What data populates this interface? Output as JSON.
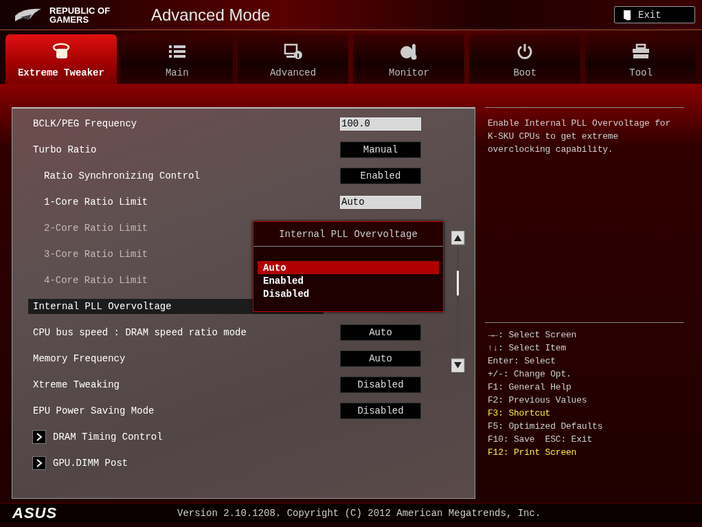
{
  "header": {
    "logo_text": "REPUBLIC OF GAMERS",
    "title": "Advanced Mode",
    "exit_button": "Exit"
  },
  "tabs": [
    {
      "label": "Extreme Tweaker",
      "kind": "tweaker",
      "selected": true
    },
    {
      "label": "Main",
      "kind": "list",
      "selected": false
    },
    {
      "label": "Advanced",
      "kind": "advanced",
      "selected": false
    },
    {
      "label": "Monitor",
      "kind": "monitor",
      "selected": false
    },
    {
      "label": "Boot",
      "kind": "power",
      "selected": false
    },
    {
      "label": "Tool",
      "kind": "tool",
      "selected": false
    }
  ],
  "settings": [
    {
      "label": "BCLK/PEG Frequency",
      "kind": "field",
      "value": "100.0",
      "disabled": false,
      "selected": false
    },
    {
      "label": "Turbo Ratio",
      "kind": "option",
      "value": "Manual",
      "disabled": false,
      "selected": false,
      "children": [
        {
          "label": "Ratio Synchronizing Control",
          "kind": "option",
          "value": "Enabled",
          "disabled": false,
          "selected": false
        },
        {
          "label": "1-Core Ratio Limit",
          "kind": "field",
          "value": "Auto",
          "disabled": false,
          "selected": false
        },
        {
          "label": "2-Core Ratio Limit",
          "kind": "none",
          "disabled": true,
          "selected": false
        },
        {
          "label": "3-Core Ratio Limit",
          "kind": "none",
          "disabled": true,
          "selected": false
        },
        {
          "label": "4-Core Ratio Limit",
          "kind": "none",
          "disabled": true,
          "selected": false
        }
      ]
    },
    {
      "label": "Internal PLL Overvoltage",
      "kind": "none",
      "disabled": false,
      "selected": true
    },
    {
      "label": "CPU bus speed : DRAM speed ratio mode",
      "kind": "option",
      "value": "Auto",
      "disabled": false,
      "selected": false
    },
    {
      "label": "Memory Frequency",
      "kind": "option",
      "value": "Auto",
      "disabled": false,
      "selected": false
    },
    {
      "label": "Xtreme Tweaking",
      "kind": "option",
      "value": "Disabled",
      "disabled": false,
      "selected": false
    },
    {
      "label": "EPU Power Saving Mode",
      "kind": "option",
      "value": "Disabled",
      "disabled": false,
      "selected": false
    },
    {
      "label": "DRAM Timing Control",
      "kind": "submenu",
      "disabled": false,
      "selected": false
    },
    {
      "label": "GPU.DIMM Post",
      "kind": "submenu",
      "disabled": false,
      "selected": false
    }
  ],
  "popup": {
    "title": "Internal PLL Overvoltage",
    "options": [
      {
        "label": "Auto",
        "selected": true
      },
      {
        "label": "Enabled",
        "selected": false
      },
      {
        "label": "Disabled",
        "selected": false
      }
    ]
  },
  "help_text": "Enable Internal PLL Overvoltage for K-SKU CPUs to get extreme overclocking capability.",
  "key_hints": [
    {
      "text": "→←: Select Screen",
      "highlight": false
    },
    {
      "text": "↑↓: Select Item",
      "highlight": false
    },
    {
      "text": "Enter: Select",
      "highlight": false
    },
    {
      "text": "+/-: Change Opt.",
      "highlight": false
    },
    {
      "text": "F1: General Help",
      "highlight": false
    },
    {
      "text": "F2: Previous Values",
      "highlight": false
    },
    {
      "text": "F3: Shortcut",
      "highlight": true
    },
    {
      "text": "F5: Optimized Defaults",
      "highlight": false
    },
    {
      "text": "F10: Save  ESC: Exit",
      "highlight": false
    },
    {
      "text": "F12: Print Screen",
      "highlight": true
    }
  ],
  "footer": {
    "brand": "ASUS",
    "version": "Version 2.10.1208. Copyright (C) 2012 American Megatrends, Inc."
  }
}
